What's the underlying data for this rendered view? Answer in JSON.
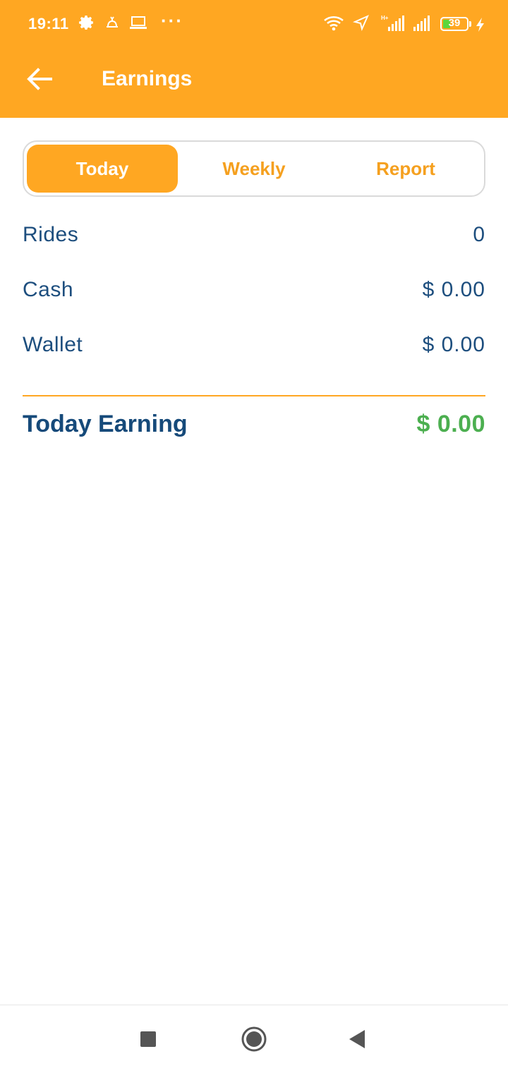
{
  "status_bar": {
    "time": "19:11",
    "battery_level": "39",
    "icons": [
      "gear-icon",
      "bell-icon",
      "laptop-icon",
      "more-dots-icon",
      "wifi-icon",
      "location-arrow-icon",
      "signal-icon",
      "signal-icon",
      "battery-icon",
      "charging-icon"
    ],
    "more_dots": "···"
  },
  "app_bar": {
    "title": "Earnings",
    "back_icon": "arrow-left-icon",
    "background": "#FFA722"
  },
  "tabs": [
    {
      "label": "Today",
      "active": true
    },
    {
      "label": "Weekly",
      "active": false
    },
    {
      "label": "Report",
      "active": false
    }
  ],
  "summary": {
    "rides": {
      "label": "Rides",
      "value": "0"
    },
    "cash": {
      "label": "Cash",
      "value": "$ 0.00"
    },
    "wallet": {
      "label": "Wallet",
      "value": "$ 0.00"
    }
  },
  "total": {
    "label": "Today Earning",
    "value": "$ 0.00"
  },
  "nav_bar": {
    "icons": [
      "recents-square-icon",
      "home-circle-icon",
      "back-triangle-icon"
    ]
  },
  "colors": {
    "accent": "#FFA722",
    "text_blue": "#1D4E7E",
    "earning_green": "#4CAF50"
  }
}
